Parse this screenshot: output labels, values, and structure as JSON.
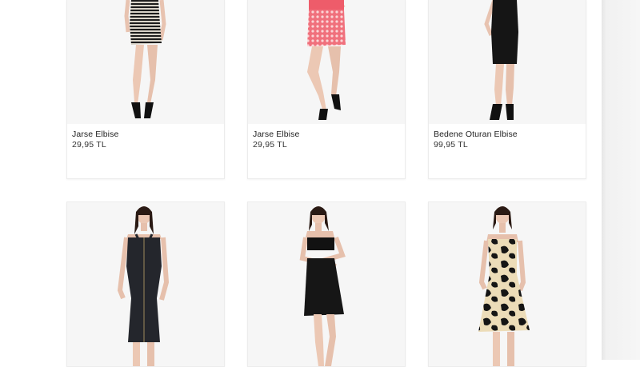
{
  "products": [
    {
      "name": "Jarse Elbise",
      "price": "29,95 TL",
      "image": "striped-bodycon-dress-photo"
    },
    {
      "name": "Jarse Elbise",
      "price": "29,95 TL",
      "image": "pink-pattern-mini-skirt-photo"
    },
    {
      "name": "Bedene Oturan Elbise",
      "price": "99,95 TL",
      "image": "black-fitted-dress-photo"
    },
    {
      "name": "",
      "price": "",
      "image": "black-zipper-midi-dress-photo"
    },
    {
      "name": "",
      "price": "",
      "image": "black-strapless-mini-dress-photo"
    },
    {
      "name": "",
      "price": "",
      "image": "black-beige-floral-midi-dress-photo"
    }
  ],
  "colors": {
    "card_background": "#ffffff",
    "image_background": "#f6f6f6",
    "text": "#222222"
  }
}
